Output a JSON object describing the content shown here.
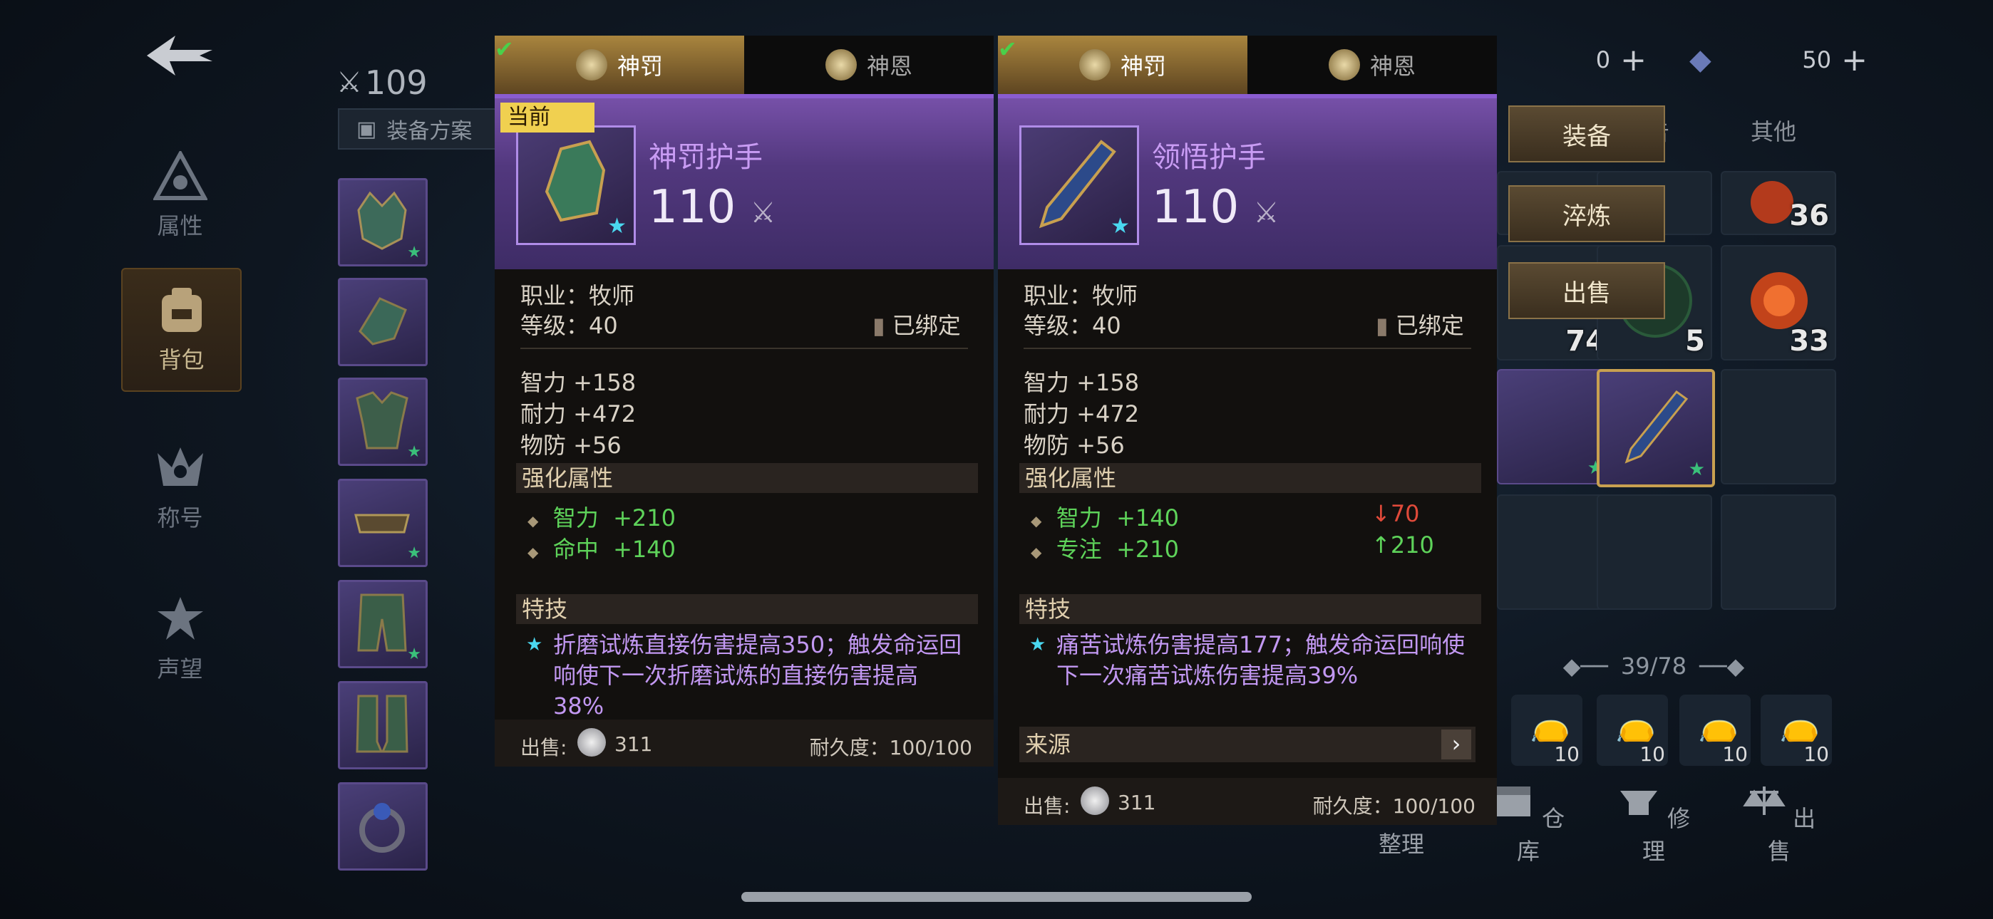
{
  "nav": {
    "items": [
      {
        "label": "属性"
      },
      {
        "label": "背包"
      },
      {
        "label": "称号"
      },
      {
        "label": "声望"
      }
    ]
  },
  "gear_score": "109",
  "equip_plan_label": "装备方案",
  "currency": {
    "a": "0",
    "b": "50"
  },
  "right_tabs": {
    "partial": "告",
    "other": "其他"
  },
  "inventory_counts": [
    "5",
    "36",
    "74",
    "5",
    "33"
  ],
  "capacity": "39/78",
  "bags": [
    "10",
    "10",
    "10",
    "10"
  ],
  "actions": {
    "equip": "装备",
    "refine": "淬炼",
    "sell": "出售"
  },
  "bottom": [
    "整理",
    "仓库",
    "修理",
    "出售"
  ],
  "panel_left": {
    "tab_active": "神罚",
    "tab_other": "神恩",
    "current_badge": "当前",
    "name": "神罚护手",
    "level": "110",
    "job": "职业：牧师",
    "req": "等级：40",
    "bound": "已绑定",
    "stats": [
      "智力  +158",
      "耐力  +472",
      "物防  +56"
    ],
    "enhance_title": "强化属性",
    "enhance": [
      {
        "name": "智力",
        "val": "+210"
      },
      {
        "name": "命中",
        "val": "+140"
      }
    ],
    "skill_title": "特技",
    "skill_desc": "折磨试炼直接伤害提高350；触发命运回响使下一次折磨试炼的直接伤害提高38%",
    "sell_label": "出售:",
    "sell_price": "311",
    "durability": "耐久度：100/100"
  },
  "panel_right": {
    "tab_active": "神罚",
    "tab_other": "神恩",
    "name": "领悟护手",
    "level": "110",
    "job": "职业：牧师",
    "req": "等级：40",
    "bound": "已绑定",
    "stats": [
      "智力  +158",
      "耐力  +472",
      "物防  +56"
    ],
    "enhance_title": "强化属性",
    "enhance": [
      {
        "name": "智力",
        "val": "+140",
        "diff": "70",
        "dir": "down"
      },
      {
        "name": "专注",
        "val": "+210",
        "diff": "210",
        "dir": "up"
      }
    ],
    "skill_title": "特技",
    "skill_desc": "痛苦试炼伤害提高177；触发命运回响使下一次痛苦试炼伤害提高39%",
    "source_label": "来源",
    "sell_label": "出售:",
    "sell_price": "311",
    "durability": "耐久度：100/100"
  }
}
